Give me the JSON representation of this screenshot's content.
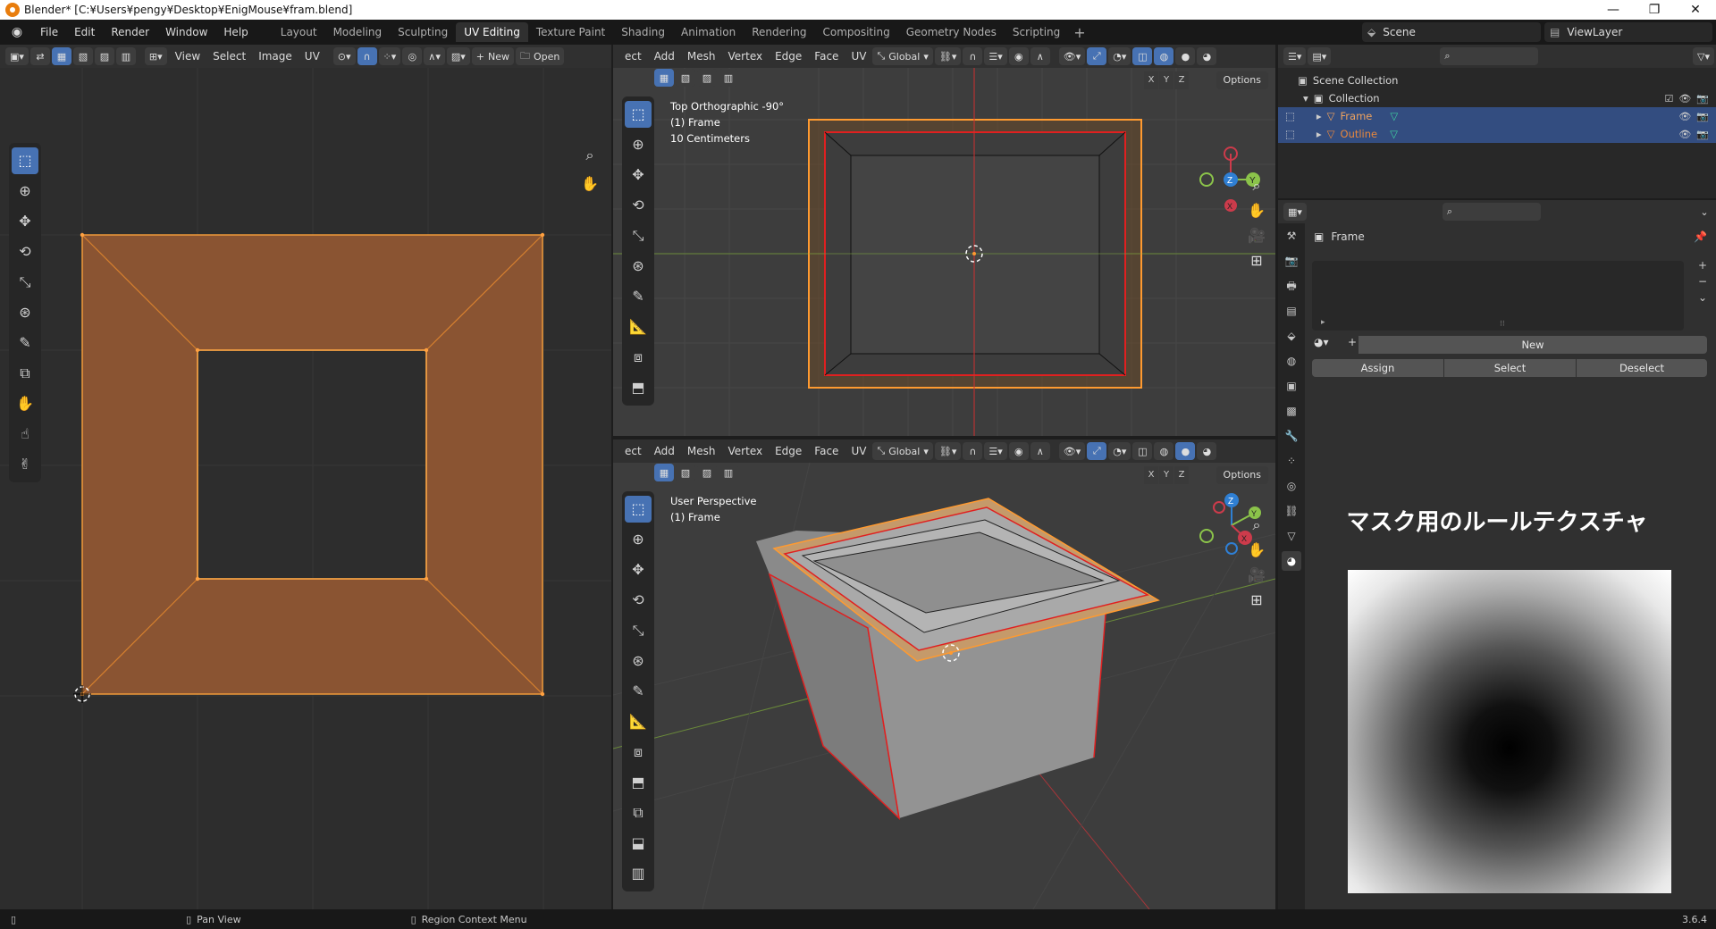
{
  "window": {
    "title": "Blender* [C:¥Users¥pengy¥Desktop¥EnigMouse¥fram.blend]",
    "controls": [
      "—",
      "❐",
      "✕"
    ]
  },
  "menu": [
    "File",
    "Edit",
    "Render",
    "Window",
    "Help"
  ],
  "workspaces": [
    "Layout",
    "Modeling",
    "Sculpting",
    "UV Editing",
    "Texture Paint",
    "Shading",
    "Animation",
    "Rendering",
    "Compositing",
    "Geometry Nodes",
    "Scripting"
  ],
  "active_workspace": "UV Editing",
  "scene": "Scene",
  "view_layer": "ViewLayer",
  "uv_editor": {
    "menus": [
      "View",
      "Select",
      "Image",
      "UV"
    ],
    "new_label": "New",
    "open_label": "Open"
  },
  "viewport_top": {
    "menus": [
      "ect",
      "Add",
      "Mesh",
      "Vertex",
      "Edge",
      "Face",
      "UV"
    ],
    "orientation": "Global",
    "info_line1": "Top Orthographic -90°",
    "info_line2": "(1) Frame",
    "info_line3": "10 Centimeters",
    "options": "Options",
    "axes": [
      "X",
      "Y",
      "Z"
    ]
  },
  "viewport_persp": {
    "menus": [
      "ect",
      "Add",
      "Mesh",
      "Vertex",
      "Edge",
      "Face",
      "UV"
    ],
    "orientation": "Global",
    "info_line1": "User Perspective",
    "info_line2": "(1) Frame",
    "options": "Options",
    "axes": [
      "X",
      "Y",
      "Z"
    ]
  },
  "outliner": {
    "root": "Scene Collection",
    "collection": "Collection",
    "objects": [
      {
        "name": "Frame",
        "color": "#f0a35e"
      },
      {
        "name": "Outline",
        "color": "#e8873c"
      }
    ]
  },
  "properties": {
    "object_name": "Frame",
    "new_label": "New",
    "assign_label": "Assign",
    "select_label": "Select",
    "deselect_label": "Deselect"
  },
  "annotation": {
    "caption": "マスク用のルールテクスチャ"
  },
  "statusbar": {
    "pan_view": "Pan View",
    "region_context": "Region Context Menu",
    "version": "3.6.4"
  },
  "colors": {
    "accent_blue": "#4772b3",
    "selected_orange": "#e8873c",
    "uv_face": "#8a5432",
    "edge_red": "#e02020"
  }
}
